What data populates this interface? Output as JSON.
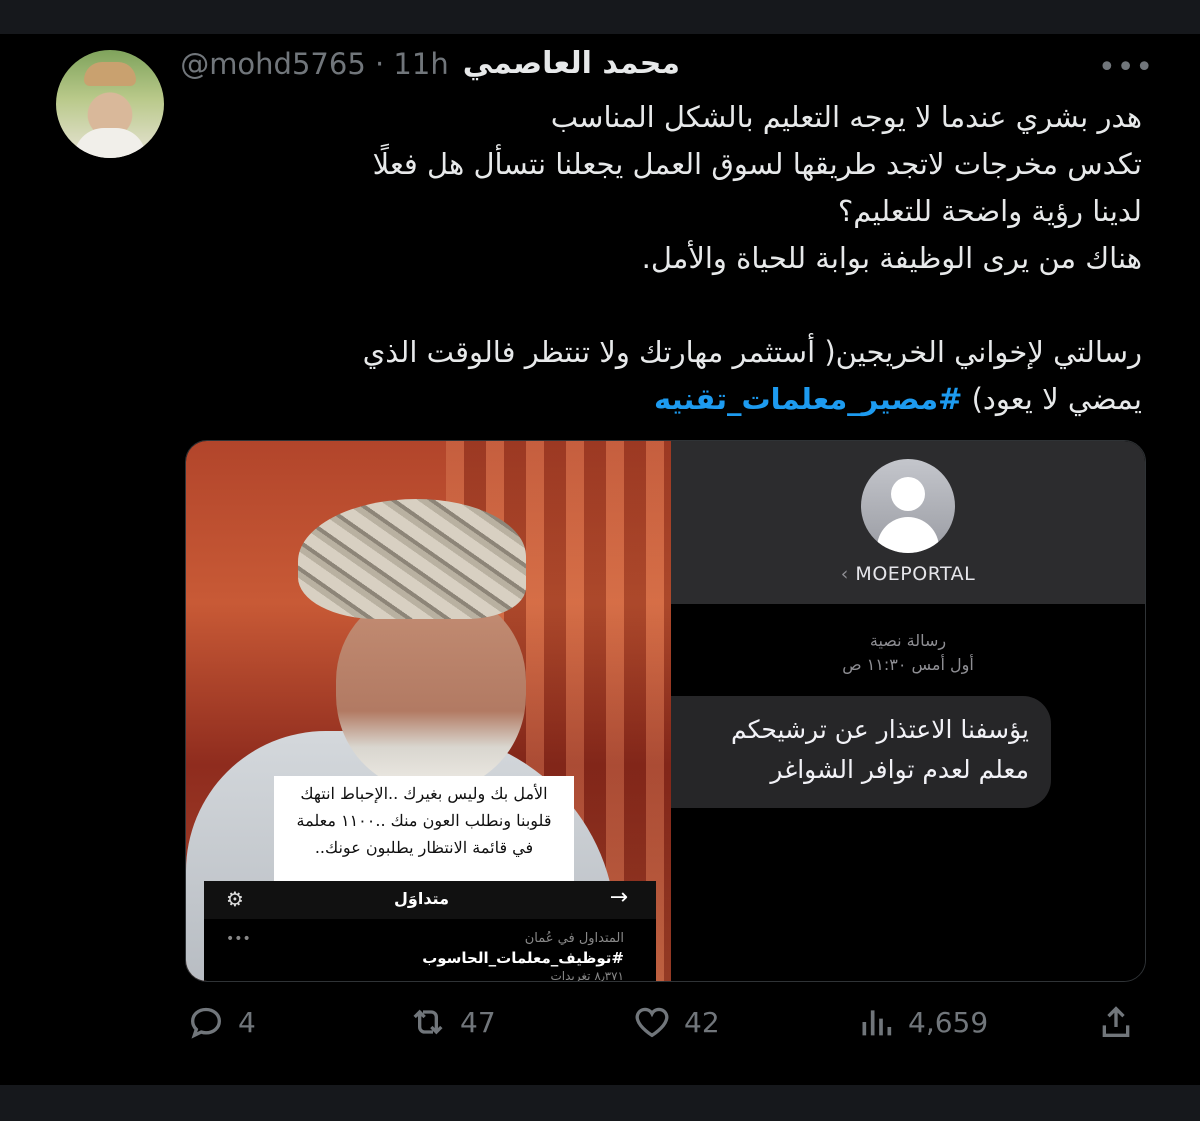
{
  "tweet": {
    "author_name": "محمد العاصمي",
    "handle_time": "@mohd5765 · 11h",
    "more_icon": "ellipsis-icon",
    "lines": [
      "هدر بشري عندما لا يوجه التعليم بالشكل المناسب",
      "تكدس مخرجات لاتجد طريقها لسوق العمل يجعلنا نتسأل هل فعلًا",
      "لدينا رؤية واضحة للتعليم؟",
      "هناك من يرى الوظيفة بوابة للحياة والأمل."
    ],
    "message_line1": "رسالتي لإخواني الخريجين( أستثمر مهارتك ولا تنتظر فالوقت الذي",
    "message_line2": "يمضي لا يعود)",
    "hashtag": "#مصير_معلمات_تقنيه"
  },
  "media": {
    "photo_caption": "الأمل بك وليس بغيرك ..الإحباط انتهك قلوبنا ونطلب العون منك ..١١٠٠ معلمة في قائمة الانتظار يطلبون عونك..",
    "trend_bar_title": "متداوَل",
    "trend_location": "المتداول في عُمان",
    "trend_tag": "#توظيف_معلمات_الحاسوب",
    "trend_count": "٨٫٣٧١ تغريدات",
    "sms_contact": "MOEPORTAL",
    "sms_type": "رسالة نصية",
    "sms_time": "أول أمس ١١:٣٠ ص",
    "sms_message": "يؤسفنا الاعتذار عن ترشيحكم معلم لعدم توافر الشواغر"
  },
  "actions": {
    "replies": "4",
    "retweets": "47",
    "likes": "42",
    "views": "4,659"
  }
}
